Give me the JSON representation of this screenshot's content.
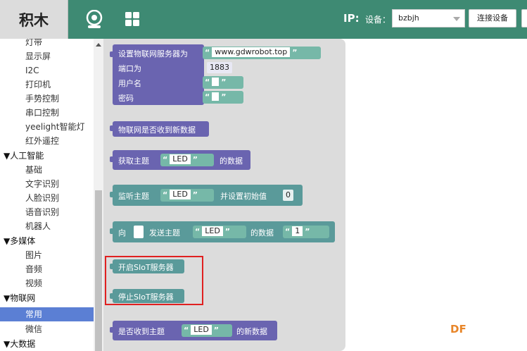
{
  "app": {
    "title": "积木"
  },
  "header": {
    "ip_label": "IP:",
    "device_label": "设备：",
    "device_value": "bzbjh",
    "connect_label": "连接设备"
  },
  "sidebar": {
    "items": [
      {
        "label": "灯带",
        "level": "sub"
      },
      {
        "label": "显示屏",
        "level": "sub"
      },
      {
        "label": "I2C",
        "level": "sub"
      },
      {
        "label": "打印机",
        "level": "sub"
      },
      {
        "label": "手势控制",
        "level": "sub"
      },
      {
        "label": "串口控制",
        "level": "sub"
      },
      {
        "label": "yeelight智能灯",
        "level": "sub"
      },
      {
        "label": "红外遥控",
        "level": "sub"
      },
      {
        "label": "▼人工智能",
        "level": "cat"
      },
      {
        "label": "基础",
        "level": "sub"
      },
      {
        "label": "文字识别",
        "level": "sub"
      },
      {
        "label": "人脸识别",
        "level": "sub"
      },
      {
        "label": "语音识别",
        "level": "sub"
      },
      {
        "label": "机器人",
        "level": "sub"
      },
      {
        "label": "▼多媒体",
        "level": "cat"
      },
      {
        "label": "图片",
        "level": "sub"
      },
      {
        "label": "音频",
        "level": "sub"
      },
      {
        "label": "视频",
        "level": "sub"
      },
      {
        "label": "▼物联网",
        "level": "cat"
      },
      {
        "label": "常用",
        "level": "sub",
        "selected": true
      },
      {
        "label": "微信",
        "level": "sub"
      },
      {
        "label": "▼大数据",
        "level": "cat"
      }
    ]
  },
  "blocks": {
    "set_server": {
      "label": "设置物联网服务器为",
      "server": "www.gdwrobot.top",
      "port_label": "端口为",
      "port": "1883",
      "user_label": "用户名",
      "password_label": "密码"
    },
    "received": {
      "label": "物联网是否收到新数据"
    },
    "get_topic": {
      "label": "获取主题",
      "topic": "LED",
      "suffix": "的数据"
    },
    "listen_topic": {
      "label": "监听主题",
      "topic": "LED",
      "middle": "并设置初始值",
      "init": "0"
    },
    "send": {
      "prefix": "向",
      "label": "发送主题",
      "topic": "LED",
      "middle": "的数据",
      "value": "1"
    },
    "start_siot": {
      "label": "开启SIoT服务器"
    },
    "stop_siot": {
      "label": "停止SIoT服务器"
    },
    "topic_received": {
      "label": "是否收到主题",
      "topic": "LED",
      "suffix": "的新数据"
    }
  },
  "quotes": {
    "open": "“",
    "close": "”"
  },
  "watermark": "DF",
  "colors": {
    "topbar": "#3e8a73",
    "purple_block": "#6a64b0",
    "teal_block": "#5a9a9a",
    "selected": "#5b7fd4",
    "highlight": "#e02020"
  }
}
